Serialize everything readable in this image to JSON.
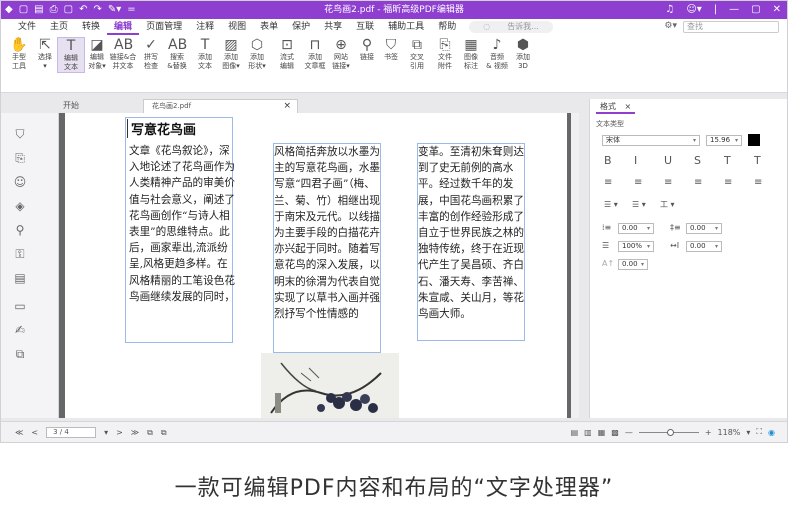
{
  "titlebar": {
    "title": "花鸟画2.pdf - 福昕高级PDF编辑器",
    "quick_access": [
      "◆",
      "▢",
      "▤",
      "⎙",
      "▢",
      "↶",
      "↷",
      "✎▾",
      "="
    ],
    "window_controls": [
      "♫",
      "☺▾",
      "|",
      "—",
      "▢",
      "✕"
    ]
  },
  "menubar": {
    "items": [
      "文件",
      "主页",
      "转换",
      "编辑",
      "页面管理",
      "注释",
      "视图",
      "表单",
      "保护",
      "共享",
      "互联",
      "辅助工具",
      "帮助"
    ],
    "active": "编辑",
    "search_placeholder": "告诉我...",
    "right_settings": "⚙▾",
    "right_search": "查找"
  },
  "ribbon": {
    "tools": [
      {
        "icon": "✋",
        "label": "手型\n工具",
        "name": "hand-tool-icon"
      },
      {
        "icon": "⇱",
        "label": "选择\n▾",
        "name": "select-tool-icon"
      },
      {
        "icon": "T",
        "label": "编辑\n文本",
        "name": "edit-text-icon"
      },
      {
        "icon": "◪",
        "label": "编辑\n对象▾",
        "name": "edit-object-icon"
      },
      {
        "icon": "AB",
        "label": "链接&合\n并文本",
        "name": "link-merge-text-icon"
      },
      {
        "icon": "✓",
        "label": "拼写\n检查",
        "name": "spell-check-icon"
      },
      {
        "icon": "AB",
        "label": "搜索\n&替换",
        "name": "search-replace-icon"
      },
      {
        "icon": "T",
        "label": "添加\n文本",
        "name": "add-text-icon"
      },
      {
        "icon": "▨",
        "label": "添加\n图像▾",
        "name": "add-image-icon"
      },
      {
        "icon": "⬡",
        "label": "添加\n形状▾",
        "name": "add-shape-icon"
      },
      {
        "icon": "⊡",
        "label": "流式\n编辑",
        "name": "flow-edit-icon"
      },
      {
        "icon": "⊓",
        "label": "添加\n文章框",
        "name": "add-article-icon"
      },
      {
        "icon": "⊕",
        "label": "网站\n链接▾",
        "name": "web-link-icon"
      },
      {
        "icon": "⚲",
        "label": "链接",
        "name": "link-icon"
      },
      {
        "icon": "⛉",
        "label": "书签",
        "name": "bookmark-icon"
      },
      {
        "icon": "⧉",
        "label": "交叉\n引用",
        "name": "cross-reference-icon"
      },
      {
        "icon": "⎘",
        "label": "文件\n附件",
        "name": "file-attachment-icon"
      },
      {
        "icon": "▦",
        "label": "图像\n标注",
        "name": "image-annotation-icon"
      },
      {
        "icon": "♪",
        "label": "音频\n& 视频",
        "name": "audio-video-icon"
      },
      {
        "icon": "⬢",
        "label": "添加\n3D",
        "name": "add-3d-icon"
      }
    ]
  },
  "tabs": {
    "home": "开始",
    "doc_tab": "花鸟画2.pdf",
    "close": "×"
  },
  "document": {
    "heading": "写意花鸟画",
    "col1": "文章《花鸟叙论》，深入地论述了花鸟画作为人类精神产品的审美价值与社会意义，阐述了花鸟画创作“与诗人相表里”的思维特点。此后，画家辈出,流派纷呈,风格更趋多样。在风格精丽的工笔设色花鸟画继续发展的同时，",
    "col2": "风格简括奔放以水墨为主的写意花鸟画，水墨写意“四君子画”（梅、兰、菊、竹）相继出现于南宋及元代。以线描为主要手段的白描花卉亦兴起于同时。随着写意花鸟的深入发展，以明末的徐渭为代表自觉实现了以草书入画并强烈抒写个性情感的",
    "col3": "变革。至清初朱耷则达到了史无前例的高水平。经过数千年的发展，中国花鸟画积累了丰富的创作经验形成了自立于世界民族之林的独特传统，终于在近现代产生了吴昌硕、齐白石、潘天寿、李苦禅、朱宣咸、关山月，等花鸟画大师。"
  },
  "right_panel": {
    "tab": "格式",
    "tab_close": "×",
    "section": "文本类型",
    "font": "宋体",
    "font_size": "15.96",
    "color": "#000000",
    "format_buttons": [
      "B",
      "I",
      "U",
      "S",
      "T",
      "T"
    ],
    "align_buttons": [
      "≡",
      "≡",
      "≡",
      "≡",
      "≡",
      "≡"
    ],
    "list_buttons": [
      "☰ ▾",
      "☰ ▾",
      "工 ▾"
    ],
    "line_spacing": "0.00",
    "para_spacing": "0.00",
    "scale": "100%",
    "char_spacing": "0.00",
    "indent": "0.00"
  },
  "statusbar": {
    "page": "3 / 4",
    "zoom": "118%",
    "nav_first": "≪",
    "nav_prev": "<",
    "nav_next": ">",
    "nav_last": "≫"
  },
  "caption": "一款可编辑PDF内容和布局的“文字处理器”"
}
